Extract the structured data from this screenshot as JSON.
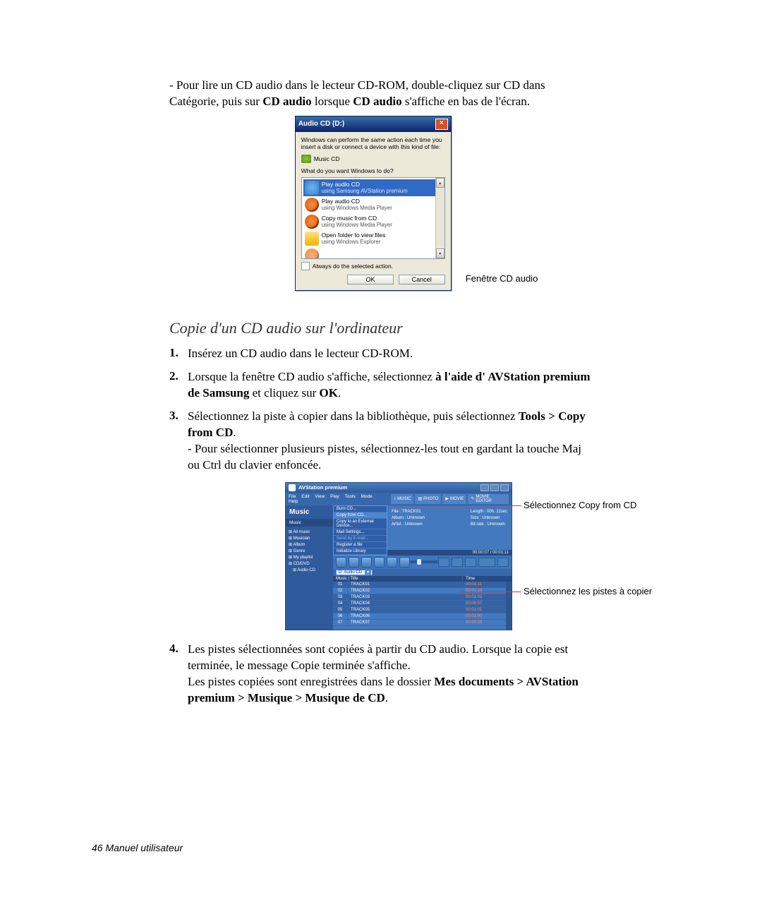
{
  "intro": {
    "p1a": "- Pour lire un CD audio dans le lecteur CD-ROM, double-cliquez sur CD dans Catégorie, puis sur ",
    "p1b": "CD audio",
    "p1c": " lorsque ",
    "p1d": "CD audio",
    "p1e": " s'affiche en bas de l'écran."
  },
  "dialog": {
    "title": "Audio CD (D:)",
    "msg": "Windows can perform the same action each time you insert a disk or connect a device with this kind of file:",
    "type": "Music CD",
    "prompt": "What do you want Windows to do?",
    "items": [
      {
        "label": "Play audio CD",
        "sub": "using Samsung AVStation premium",
        "selected": true,
        "icon": "blue"
      },
      {
        "label": "Play audio CD",
        "sub": "using Windows Media Player",
        "selected": false,
        "icon": "orange"
      },
      {
        "label": "Copy music from CD",
        "sub": "using Windows Media Player",
        "selected": false,
        "icon": "orange"
      },
      {
        "label": "Open folder to view files",
        "sub": "using Windows Explorer",
        "selected": false,
        "icon": "folder"
      }
    ],
    "checkbox": "Always do the selected action.",
    "ok": "OK",
    "cancel": "Cancel",
    "caption": "Fenêtre CD audio"
  },
  "section": {
    "heading": "Copie d'un CD audio sur l'ordinateur",
    "steps": {
      "s1": "Insérez un CD audio dans le lecteur CD-ROM.",
      "s2a": "Lorsque la fenêtre CD audio s'affiche, sélectionnez ",
      "s2b": "à l'aide d' AVStation premium de Samsung",
      "s2c": " et cliquez sur ",
      "s2d": "OK",
      "s2e": ".",
      "s3a": "Sélectionnez la piste à copier dans la bibliothèque, puis sélectionnez ",
      "s3b": "Tools > Copy from CD",
      "s3c": ".",
      "s3sub": "- Pour sélectionner plusieurs pistes, sélectionnez-les tout en gardant la touche Maj ou Ctrl du clavier enfoncée.",
      "s4a": "Les pistes sélectionnées sont copiées à partir du CD audio. Lorsque la copie est terminée, le message Copie terminée s'affiche.",
      "s4b1": "Les pistes copiées sont enregistrées dans le dossier ",
      "s4b2": "Mes documents > AVStation premium > Musique > Musique de CD",
      "s4b3": "."
    }
  },
  "av": {
    "title": "AVStation premium",
    "menu": [
      "File",
      "Edit",
      "View",
      "Play",
      "Tools",
      "Mode",
      "Help"
    ],
    "tabs": [
      "MUSIC",
      "PHOTO",
      "MOVIE",
      "MOVIE EDITOR"
    ],
    "side_heading": "Music",
    "side_sub": "Music",
    "tree": [
      "All music",
      "Musician",
      "Album",
      "Genre",
      "My playlist",
      "CD/DVD",
      "Audio CD"
    ],
    "ctx": [
      "Burn CD...",
      "Copy from CD...",
      "Copy to an External Device...",
      "Mail Settings...",
      "Send by E-mail...",
      "Register a file",
      "Initialize Library"
    ],
    "info_left": [
      "File : TRACK01",
      "Album : Unknown",
      "Artist : Unknown"
    ],
    "info_right": [
      "Length : 00h. 11sec",
      "Size : Unknown",
      "Bit rate : Unknown"
    ],
    "timebar": "00:00:07 / 00:01:11",
    "dropdown": "D: Audio CD",
    "cols": [
      "Music | Title",
      "Time"
    ],
    "rows": [
      {
        "n": "01",
        "t": "TRACK01",
        "d": "00:01:11",
        "sel": true
      },
      {
        "n": "02",
        "t": "TRACK02",
        "d": "00:01:19",
        "sel": false
      },
      {
        "n": "03",
        "t": "TRACK03",
        "d": "00:01:02",
        "sel": true
      },
      {
        "n": "04",
        "t": "TRACK04",
        "d": "00:00:57",
        "sel": true
      },
      {
        "n": "05",
        "t": "TRACK05",
        "d": "00:01:01",
        "sel": true
      },
      {
        "n": "06",
        "t": "TRACK06",
        "d": "00:01:00",
        "sel": false
      },
      {
        "n": "07",
        "t": "TRACK07",
        "d": "00:00:59",
        "sel": false
      }
    ],
    "ann1": "Sélectionnez Copy from CD",
    "ann2": "Sélectionnez les pistes à copier"
  },
  "footer": "46  Manuel utilisateur"
}
